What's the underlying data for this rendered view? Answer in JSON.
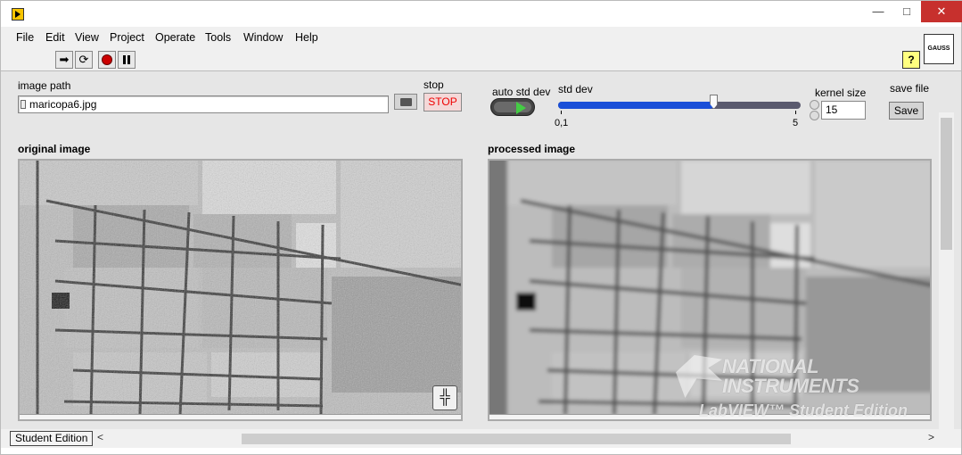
{
  "window": {
    "min_symbol": "—",
    "max_symbol": "□",
    "close_symbol": "✕"
  },
  "menu": [
    "File",
    "Edit",
    "View",
    "Project",
    "Operate",
    "Tools",
    "Window",
    "Help"
  ],
  "toolbar": {
    "help_label": "?",
    "vi_icon_label": "GAUSS"
  },
  "controls": {
    "image_path_label": "image path",
    "image_path_value": "maricopa6.jpg",
    "stop_label": "stop",
    "stop_button": "STOP",
    "auto_std_dev_label": "auto std dev",
    "std_dev_label": "std dev",
    "std_dev_min": "0,1",
    "std_dev_max": "5",
    "std_dev_value_fraction": 0.64,
    "kernel_size_label": "kernel size",
    "kernel_size_value": "15",
    "save_file_label": "save file",
    "save_button": "Save"
  },
  "displays": {
    "original_label": "original image",
    "processed_label": "processed image"
  },
  "watermark": {
    "line1": "NATIONAL",
    "line2": "INSTRUMENTS",
    "line3": "LabVIEW™ Student Edition"
  },
  "status": {
    "edition": "Student Edition"
  },
  "colors": {
    "stop_text": "#e00000",
    "slider_fill": "#1a4fd8",
    "led_green": "#44cc44"
  }
}
